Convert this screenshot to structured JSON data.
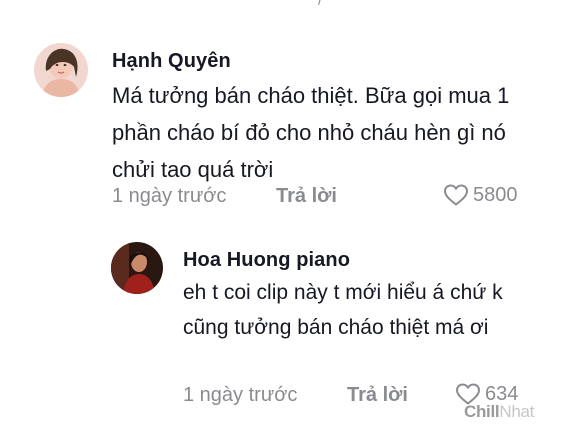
{
  "comments": [
    {
      "username": "Hạnh Quyên",
      "text": "Má tưởng bán cháo thiệt. Bữa gọi mua 1 phần cháo bí đỏ cho nhỏ cháu hèn gì nó chửi tao quá trời",
      "time": "1 ngày trước",
      "reply_label": "Trả lời",
      "likes": "5800"
    },
    {
      "username": "Hoa Huong piano",
      "text": "eh t coi clip này t mới hiểu á chứ k cũng tưởng bán cháo thiệt má ơi",
      "time": "1 ngày trước",
      "reply_label": "Trả lời",
      "likes": "634"
    }
  ],
  "watermark": {
    "part1": "Chill",
    "part2": "Nhat"
  },
  "icons": {
    "like": "heart-outline-icon"
  }
}
